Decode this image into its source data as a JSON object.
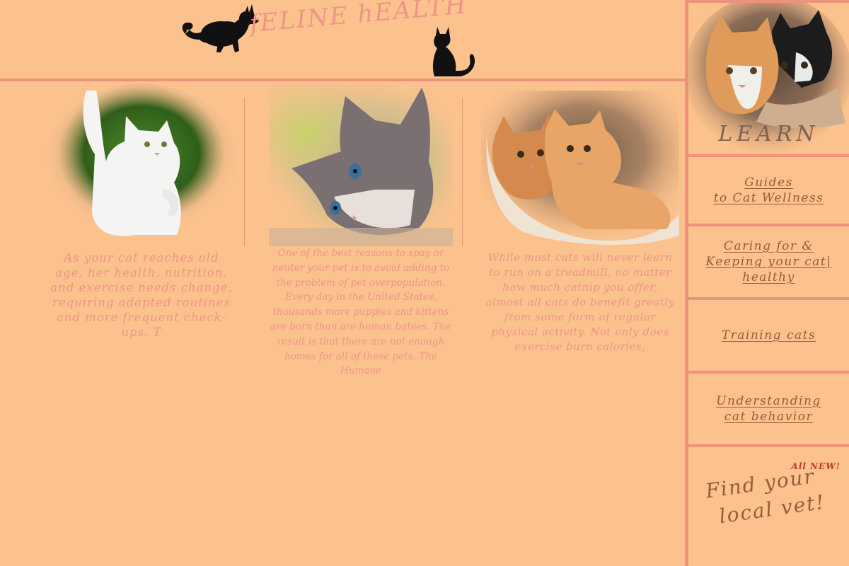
{
  "header": {
    "site_title": "fELINE hEALTH"
  },
  "articles": [
    {
      "excerpt": "As your cat reaches old age, her health, nutrition, and exercise needs change, requiring adapted routines and more frequent check-ups. T",
      "image": "white-cat-running"
    },
    {
      "excerpt": "One of the best reasons to spay or neuter your pet is to avoid adding to the problem of pet overpopulation. Every day in the United States, thousands more puppies and kittens are born than are human babies. The result is that there are not enough homes for all of these pets. The Humane",
      "image": "grey-kitten-blue-eyes"
    },
    {
      "excerpt": "While most cats will never learn to run on a treadmill, no matter how much catnip you offer, almost all cats do benefit greatly from some form of regular physical activity. Not only does exercise burn calories,",
      "image": "two-ginger-cats-in-bowl"
    }
  ],
  "sidebar": {
    "learn_label": "LEARN",
    "guides": [
      "Guides",
      "to Cat Wellness"
    ],
    "caring": [
      "Caring for &",
      "Keeping your cat|",
      "healthy"
    ],
    "training": "Training cats",
    "understanding": [
      "Understanding",
      "cat behavior"
    ],
    "vet_badge": "All NEW!",
    "vet_link": [
      "Find your",
      "local vet!"
    ]
  },
  "colors": {
    "background": "#fcc28d",
    "rule": "#f0917c",
    "title_pink": "#ee9488",
    "link_brown": "#a0563a",
    "badge_red": "#c0392b"
  }
}
